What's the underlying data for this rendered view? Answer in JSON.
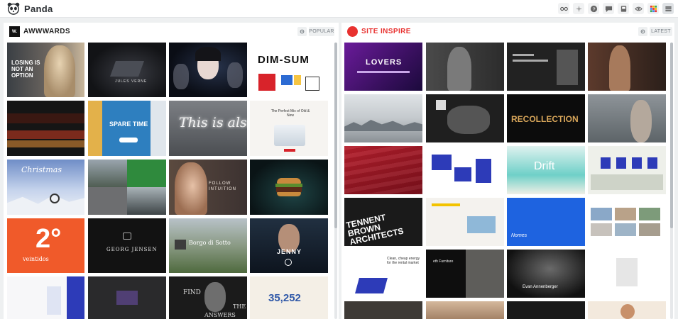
{
  "app": {
    "name": "Panda"
  },
  "toolbar": {
    "icons": [
      "feeds-icon",
      "collections-icon",
      "help-icon",
      "chat-icon",
      "mailbox-icon",
      "eye-icon",
      "apps-grid-icon",
      "menu-icon"
    ]
  },
  "columns": [
    {
      "source": "AWWWARDS",
      "logo_text": "W.",
      "button": "POPULAR",
      "accent": "#111111"
    },
    {
      "source": "SITE INSPIRE",
      "button": "LATEST",
      "accent": "#e8312f"
    }
  ],
  "thumbnails_text": {
    "losing": "LOSING IS NOT AN OPTION",
    "jules": "JULES VERNE",
    "dimsum": "DIM-SUM",
    "spare": "SPARE TIME",
    "thisalso": "This is also",
    "perfect": "The Perfect Mix of Old & New",
    "christmas": "Christmas",
    "follow": "FOLLOW INTUITION",
    "veintidos": "veintidos",
    "jensen": "GEORG JENSEN",
    "borgo": "Borgo di Sotto",
    "jenny": "JENNY",
    "find": "FIND",
    "the": "THE",
    "answers": "ANSWERS",
    "number": "35,252",
    "lovers": "LOVERS",
    "recollection": "RECOLLECTION",
    "drift": "Drift",
    "tennent": "TENNENT BROWN ARCHITECTS",
    "clean": "Clean, cheap energy for the rental market",
    "furniture": "eth Furniture",
    "ansen": "Evan Annenberger",
    "nomes": "Nomes"
  }
}
